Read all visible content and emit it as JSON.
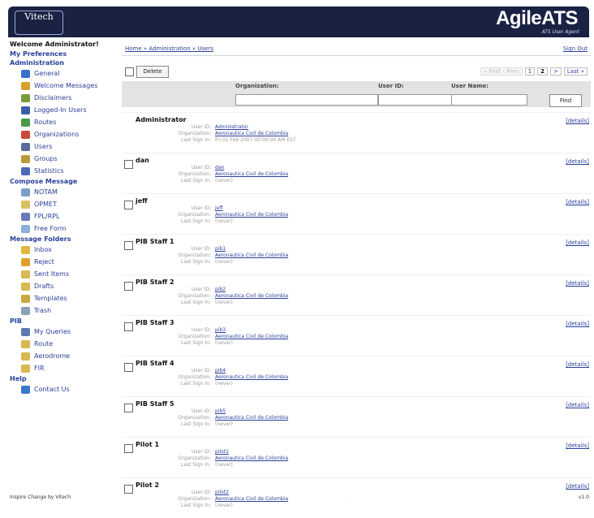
{
  "header": {
    "logo_left": "Vitech",
    "brand": "AgileATS",
    "brand_sub": "ATS User Agent"
  },
  "sidebar": {
    "welcome": "Welcome Administrator!",
    "sections": [
      {
        "title": "My Preferences",
        "items": []
      },
      {
        "title": "Administration",
        "items": [
          {
            "label": "General",
            "icon": "general-icon",
            "color": "#3a6fc7"
          },
          {
            "label": "Welcome Messages",
            "icon": "welcome-messages-icon",
            "color": "#d7a12a"
          },
          {
            "label": "Disclaimers",
            "icon": "disclaimers-icon",
            "color": "#7a9a3a"
          },
          {
            "label": "Logged-In Users",
            "icon": "logged-in-users-icon",
            "color": "#3a5fa8"
          },
          {
            "label": "Routes",
            "icon": "routes-icon",
            "color": "#4a9a4a"
          },
          {
            "label": "Organizations",
            "icon": "organizations-icon",
            "color": "#c84a3a"
          },
          {
            "label": "Users",
            "icon": "users-icon",
            "color": "#5a6a9a"
          },
          {
            "label": "Groups",
            "icon": "groups-icon",
            "color": "#b89a3a"
          },
          {
            "label": "Statistics",
            "icon": "statistics-icon",
            "color": "#4a6ab8"
          }
        ]
      },
      {
        "title": "Compose Message",
        "items": [
          {
            "label": "NOTAM",
            "icon": "notam-icon",
            "color": "#7aa0c8"
          },
          {
            "label": "OPMET",
            "icon": "opmet-icon",
            "color": "#d8c060"
          },
          {
            "label": "FPL/RPL",
            "icon": "fpl-icon",
            "color": "#6a7ab8"
          },
          {
            "label": "Free Form",
            "icon": "free-form-icon",
            "color": "#8ab0d8"
          }
        ]
      },
      {
        "title": "Message Folders",
        "items": [
          {
            "label": "Inbox",
            "icon": "inbox-icon",
            "color": "#e0b840"
          },
          {
            "label": "Reject",
            "icon": "reject-icon",
            "color": "#e0a030"
          },
          {
            "label": "Sent Items",
            "icon": "sent-items-icon",
            "color": "#d8b850"
          },
          {
            "label": "Drafts",
            "icon": "drafts-icon",
            "color": "#d8b850"
          },
          {
            "label": "Templates",
            "icon": "templates-icon",
            "color": "#c8a840"
          },
          {
            "label": "Trash",
            "icon": "trash-icon",
            "color": "#8aa0b8"
          }
        ]
      },
      {
        "title": "PIB",
        "items": [
          {
            "label": "My Queries",
            "icon": "my-queries-icon",
            "color": "#5a7ab0"
          },
          {
            "label": "Route",
            "icon": "route-icon",
            "color": "#d8b850"
          },
          {
            "label": "Aerodrome",
            "icon": "aerodrome-icon",
            "color": "#d8b850"
          },
          {
            "label": "FIR",
            "icon": "fir-icon",
            "color": "#d8b850"
          }
        ]
      },
      {
        "title": "Help",
        "items": [
          {
            "label": "Contact Us",
            "icon": "contact-us-icon",
            "color": "#3a78c8"
          }
        ]
      }
    ]
  },
  "topbar": {
    "breadcrumb": "Home » Administration » Users",
    "sign_out": "Sign Out"
  },
  "actions": {
    "delete": "Delete",
    "pager": {
      "first_prev": "« First  ‹ Prev",
      "page1": "1",
      "page2": "2",
      "next": ">",
      "last": "Last »"
    }
  },
  "search": {
    "org_label": "Organization:",
    "userid_label": "User ID:",
    "username_label": "User Name:",
    "find": "Find"
  },
  "field_labels": {
    "userid": "User ID:",
    "org": "Organization:",
    "last": "Last Sign In:"
  },
  "details_label": "[details]",
  "users": [
    {
      "name": "Administrator",
      "userid": "Administrator",
      "org": "Aeronautica Civil de Colombia",
      "last": "Fri 02 Feb 2007 00:00:00 AM EST"
    },
    {
      "name": "dan",
      "userid": "dan",
      "org": "Aeronautica Civil de Colombia",
      "last": "(never)"
    },
    {
      "name": "jeff",
      "userid": "jeff",
      "org": "Aeronautica Civil de Colombia",
      "last": "(never)"
    },
    {
      "name": "PIB Staff 1",
      "userid": "pib1",
      "org": "Aeronautica Civil de Colombia",
      "last": "(never)"
    },
    {
      "name": "PIB Staff 2",
      "userid": "pib2",
      "org": "Aeronautica Civil de Colombia",
      "last": "(never)"
    },
    {
      "name": "PIB Staff 3",
      "userid": "pib3",
      "org": "Aeronautica Civil de Colombia",
      "last": "(never)"
    },
    {
      "name": "PIB Staff 4",
      "userid": "pib4",
      "org": "Aeronautica Civil de Colombia",
      "last": "(never)"
    },
    {
      "name": "PIB Staff 5",
      "userid": "pib5",
      "org": "Aeronautica Civil de Colombia",
      "last": "(never)"
    },
    {
      "name": "Pilot 1",
      "userid": "pilot1",
      "org": "Aeronautica Civil de Colombia",
      "last": "(never)"
    },
    {
      "name": "Pilot 2",
      "userid": "pilot2",
      "org": "Aeronautica Civil de Colombia",
      "last": "(never)"
    }
  ],
  "footer": {
    "left": "Inspire Change by Vitech",
    "middle": "·",
    "right": "v1.0"
  }
}
